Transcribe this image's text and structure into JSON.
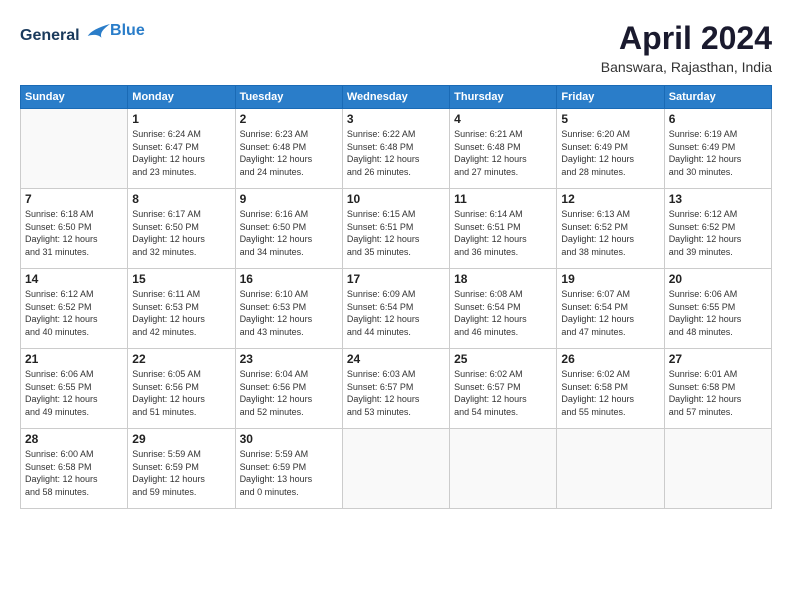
{
  "header": {
    "logo_line1": "General",
    "logo_line2": "Blue",
    "title": "April 2024",
    "location": "Banswara, Rajasthan, India"
  },
  "columns": [
    "Sunday",
    "Monday",
    "Tuesday",
    "Wednesday",
    "Thursday",
    "Friday",
    "Saturday"
  ],
  "weeks": [
    [
      {
        "day": "",
        "info": ""
      },
      {
        "day": "1",
        "info": "Sunrise: 6:24 AM\nSunset: 6:47 PM\nDaylight: 12 hours\nand 23 minutes."
      },
      {
        "day": "2",
        "info": "Sunrise: 6:23 AM\nSunset: 6:48 PM\nDaylight: 12 hours\nand 24 minutes."
      },
      {
        "day": "3",
        "info": "Sunrise: 6:22 AM\nSunset: 6:48 PM\nDaylight: 12 hours\nand 26 minutes."
      },
      {
        "day": "4",
        "info": "Sunrise: 6:21 AM\nSunset: 6:48 PM\nDaylight: 12 hours\nand 27 minutes."
      },
      {
        "day": "5",
        "info": "Sunrise: 6:20 AM\nSunset: 6:49 PM\nDaylight: 12 hours\nand 28 minutes."
      },
      {
        "day": "6",
        "info": "Sunrise: 6:19 AM\nSunset: 6:49 PM\nDaylight: 12 hours\nand 30 minutes."
      }
    ],
    [
      {
        "day": "7",
        "info": "Sunrise: 6:18 AM\nSunset: 6:50 PM\nDaylight: 12 hours\nand 31 minutes."
      },
      {
        "day": "8",
        "info": "Sunrise: 6:17 AM\nSunset: 6:50 PM\nDaylight: 12 hours\nand 32 minutes."
      },
      {
        "day": "9",
        "info": "Sunrise: 6:16 AM\nSunset: 6:50 PM\nDaylight: 12 hours\nand 34 minutes."
      },
      {
        "day": "10",
        "info": "Sunrise: 6:15 AM\nSunset: 6:51 PM\nDaylight: 12 hours\nand 35 minutes."
      },
      {
        "day": "11",
        "info": "Sunrise: 6:14 AM\nSunset: 6:51 PM\nDaylight: 12 hours\nand 36 minutes."
      },
      {
        "day": "12",
        "info": "Sunrise: 6:13 AM\nSunset: 6:52 PM\nDaylight: 12 hours\nand 38 minutes."
      },
      {
        "day": "13",
        "info": "Sunrise: 6:12 AM\nSunset: 6:52 PM\nDaylight: 12 hours\nand 39 minutes."
      }
    ],
    [
      {
        "day": "14",
        "info": "Sunrise: 6:12 AM\nSunset: 6:52 PM\nDaylight: 12 hours\nand 40 minutes."
      },
      {
        "day": "15",
        "info": "Sunrise: 6:11 AM\nSunset: 6:53 PM\nDaylight: 12 hours\nand 42 minutes."
      },
      {
        "day": "16",
        "info": "Sunrise: 6:10 AM\nSunset: 6:53 PM\nDaylight: 12 hours\nand 43 minutes."
      },
      {
        "day": "17",
        "info": "Sunrise: 6:09 AM\nSunset: 6:54 PM\nDaylight: 12 hours\nand 44 minutes."
      },
      {
        "day": "18",
        "info": "Sunrise: 6:08 AM\nSunset: 6:54 PM\nDaylight: 12 hours\nand 46 minutes."
      },
      {
        "day": "19",
        "info": "Sunrise: 6:07 AM\nSunset: 6:54 PM\nDaylight: 12 hours\nand 47 minutes."
      },
      {
        "day": "20",
        "info": "Sunrise: 6:06 AM\nSunset: 6:55 PM\nDaylight: 12 hours\nand 48 minutes."
      }
    ],
    [
      {
        "day": "21",
        "info": "Sunrise: 6:06 AM\nSunset: 6:55 PM\nDaylight: 12 hours\nand 49 minutes."
      },
      {
        "day": "22",
        "info": "Sunrise: 6:05 AM\nSunset: 6:56 PM\nDaylight: 12 hours\nand 51 minutes."
      },
      {
        "day": "23",
        "info": "Sunrise: 6:04 AM\nSunset: 6:56 PM\nDaylight: 12 hours\nand 52 minutes."
      },
      {
        "day": "24",
        "info": "Sunrise: 6:03 AM\nSunset: 6:57 PM\nDaylight: 12 hours\nand 53 minutes."
      },
      {
        "day": "25",
        "info": "Sunrise: 6:02 AM\nSunset: 6:57 PM\nDaylight: 12 hours\nand 54 minutes."
      },
      {
        "day": "26",
        "info": "Sunrise: 6:02 AM\nSunset: 6:58 PM\nDaylight: 12 hours\nand 55 minutes."
      },
      {
        "day": "27",
        "info": "Sunrise: 6:01 AM\nSunset: 6:58 PM\nDaylight: 12 hours\nand 57 minutes."
      }
    ],
    [
      {
        "day": "28",
        "info": "Sunrise: 6:00 AM\nSunset: 6:58 PM\nDaylight: 12 hours\nand 58 minutes."
      },
      {
        "day": "29",
        "info": "Sunrise: 5:59 AM\nSunset: 6:59 PM\nDaylight: 12 hours\nand 59 minutes."
      },
      {
        "day": "30",
        "info": "Sunrise: 5:59 AM\nSunset: 6:59 PM\nDaylight: 13 hours\nand 0 minutes."
      },
      {
        "day": "",
        "info": ""
      },
      {
        "day": "",
        "info": ""
      },
      {
        "day": "",
        "info": ""
      },
      {
        "day": "",
        "info": ""
      }
    ]
  ]
}
